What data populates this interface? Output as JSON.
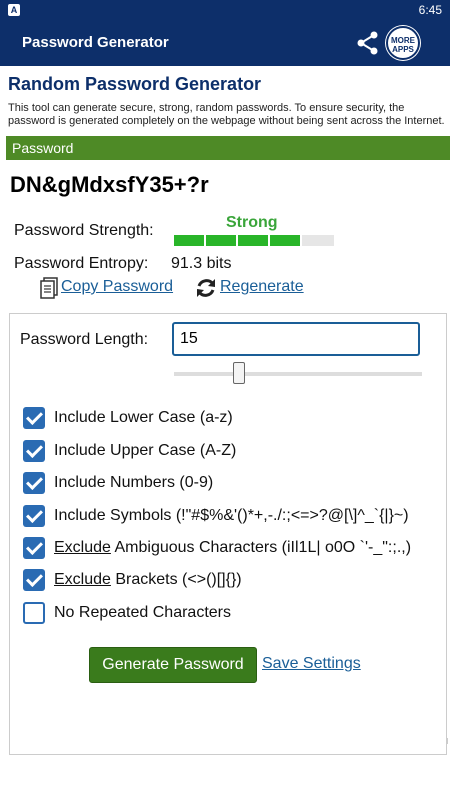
{
  "status_bar": {
    "time": "6:45",
    "app_icon": "A"
  },
  "app_bar": {
    "title": "Password Generator",
    "share_icon": "share-icon",
    "more_apps": "MORE APPS"
  },
  "page": {
    "heading": "Random Password Generator",
    "description": "This tool can generate secure, strong, random passwords. To ensure security, the password is generated completely on the webpage without being sent across the Internet.",
    "password_section_label": "Password",
    "password": "DN&gMdxsfY35+?r",
    "strength_label": "Password Strength:",
    "strength_value": "Strong",
    "strength_fraction": 0.8,
    "entropy_label": "Password Entropy:",
    "entropy_value": "91.3 bits",
    "copy_link": "Copy Password",
    "regenerate_link": "Regenerate"
  },
  "settings": {
    "length_label": "Password Length:",
    "length_value": "15",
    "options": [
      {
        "prefix": "",
        "label": "Include Lower Case (a-z)",
        "checked": true
      },
      {
        "prefix": "",
        "label": "Include Upper Case (A-Z)",
        "checked": true
      },
      {
        "prefix": "",
        "label": "Include Numbers (0-9)",
        "checked": true
      },
      {
        "prefix": "",
        "label": "Include Symbols (!\"#$%&'()*+,-./:;<=>?@[\\]^_`{|}~)",
        "checked": true
      },
      {
        "prefix": "Exclude",
        "label": " Ambiguous Characters (iIl1L| o0O `'-_\":;.,)",
        "checked": true
      },
      {
        "prefix": "Exclude",
        "label": " Brackets (<>()[]{})",
        "checked": true
      },
      {
        "prefix": "",
        "label": "No Repeated Characters",
        "checked": false
      }
    ],
    "generate_button": "Generate Password",
    "save_link": "Save Settings"
  },
  "colors": {
    "primary": "#0d2f6a",
    "section_green": "#4e8a26",
    "strong_green": "#29b529",
    "link": "#1a5e97",
    "checkbox": "#2a6bb3"
  }
}
